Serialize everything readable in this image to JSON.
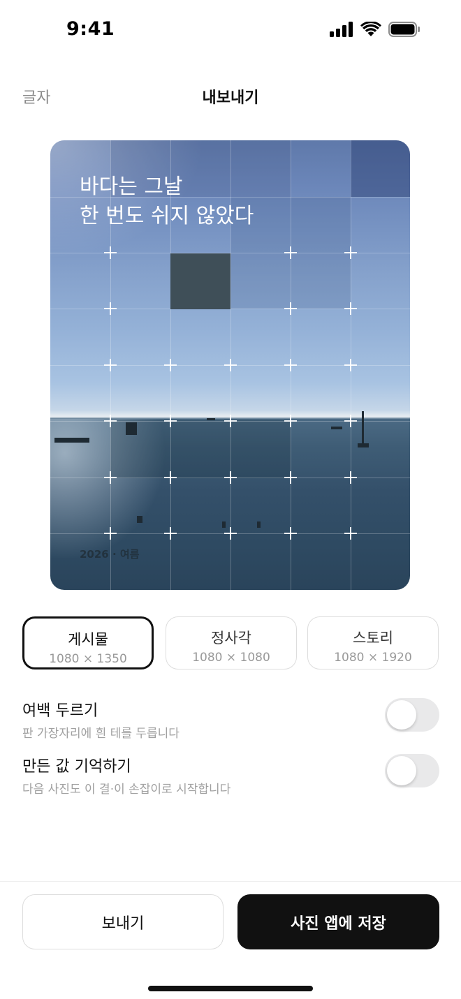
{
  "status_bar": {
    "time": "9:41"
  },
  "nav": {
    "back_label": "글자",
    "title": "내보내기"
  },
  "preview": {
    "headline": "바다는 그날\n한 번도 쉬지 않았다",
    "caption": "2026 · 여름"
  },
  "formats": [
    {
      "name": "게시물",
      "size": "1080 × 1350",
      "selected": true
    },
    {
      "name": "정사각",
      "size": "1080 × 1080",
      "selected": false
    },
    {
      "name": "스토리",
      "size": "1080 × 1920",
      "selected": false
    }
  ],
  "settings": [
    {
      "title": "여백 두르기",
      "description": "판 가장자리에 흰 테를 두릅니다",
      "enabled": false
    },
    {
      "title": "만든 값 기억하기",
      "description": "다음 사진도 이 결·이 손잡이로 시작합니다",
      "enabled": false
    }
  ],
  "actions": {
    "share_label": "보내기",
    "save_label": "사진 앱에 저장"
  },
  "colors": {
    "primary": "#111111",
    "toggle_off": "#e9e9ea",
    "muted_text": "#a0a0a0"
  }
}
